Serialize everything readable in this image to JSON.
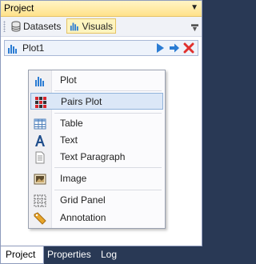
{
  "window": {
    "title": "Project"
  },
  "toolbar": {
    "datasets_label": "Datasets",
    "visuals_label": "Visuals"
  },
  "plot_item": {
    "label": "Plot1"
  },
  "context_menu": {
    "items": [
      {
        "label": "Plot",
        "icon": "bar-chart-icon"
      },
      {
        "label": "Pairs Plot",
        "icon": "pairs-grid-icon",
        "highlighted": true
      },
      {
        "label": "Table",
        "icon": "table-icon"
      },
      {
        "label": "Text",
        "icon": "letter-a-icon"
      },
      {
        "label": "Text Paragraph",
        "icon": "document-icon"
      },
      {
        "label": "Image",
        "icon": "image-icon"
      },
      {
        "label": "Grid Panel",
        "icon": "grid-icon"
      },
      {
        "label": "Annotation",
        "icon": "tag-icon"
      }
    ]
  },
  "bottom_tabs": [
    {
      "label": "Project",
      "active": true
    },
    {
      "label": "Properties"
    },
    {
      "label": "Log"
    }
  ],
  "colors": {
    "title_bar": "#ffe28a",
    "selection": "#dbe7f7",
    "tab_strip": "#293955",
    "accent_blue": "#2b7cd3",
    "delete_red": "#e0302d"
  }
}
